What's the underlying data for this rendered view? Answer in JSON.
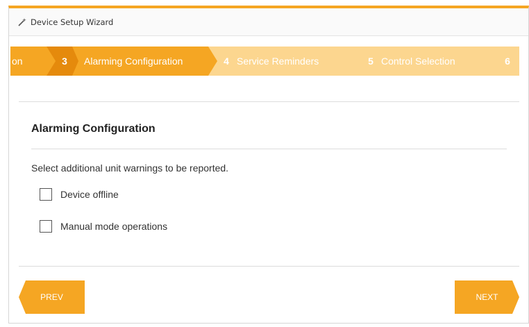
{
  "header": {
    "title": "Device Setup Wizard"
  },
  "steps": [
    {
      "number": "",
      "label": "on",
      "state": "completed"
    },
    {
      "number": "3",
      "label": "Alarming Configuration",
      "state": "active"
    },
    {
      "number": "4",
      "label": "Service Reminders",
      "state": "upcoming"
    },
    {
      "number": "5",
      "label": "Control Selection",
      "state": "upcoming"
    },
    {
      "number": "6",
      "label": "",
      "state": "upcoming"
    }
  ],
  "main": {
    "section_title": "Alarming Configuration",
    "instruction": "Select additional unit warnings to be reported.",
    "options": [
      {
        "label": "Device offline",
        "checked": false
      },
      {
        "label": "Manual mode operations",
        "checked": false
      }
    ]
  },
  "footer": {
    "prev_label": "PREV",
    "next_label": "NEXT"
  },
  "colors": {
    "accent": "#f5a623",
    "accent_dark": "#e58a0c",
    "accent_light": "#fcd68f"
  }
}
